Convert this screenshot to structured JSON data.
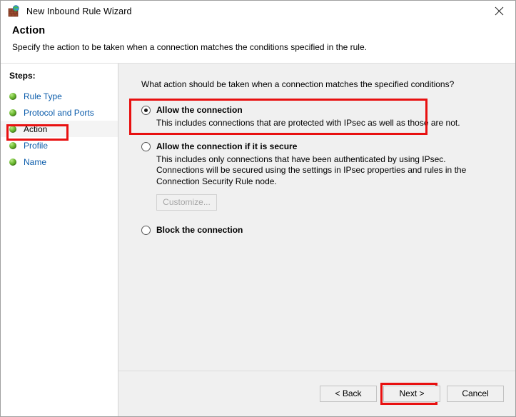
{
  "window": {
    "title": "New Inbound Rule Wizard",
    "icon": "firewall-globe-icon",
    "close_label": "×"
  },
  "header": {
    "title": "Action",
    "subtitle": "Specify the action to be taken when a connection matches the conditions specified in the rule."
  },
  "sidebar": {
    "label": "Steps:",
    "items": [
      {
        "label": "Rule Type",
        "current": false
      },
      {
        "label": "Protocol and Ports",
        "current": false
      },
      {
        "label": "Action",
        "current": true
      },
      {
        "label": "Profile",
        "current": false
      },
      {
        "label": "Name",
        "current": false
      }
    ]
  },
  "main": {
    "question": "What action should be taken when a connection matches the specified conditions?",
    "options": [
      {
        "title": "Allow the connection",
        "description": "This includes connections that are protected with IPsec as well as those are not.",
        "selected": true
      },
      {
        "title": "Allow the connection if it is secure",
        "description": "This includes only connections that have been authenticated by using IPsec.  Connections will be secured using the settings in IPsec properties and rules in the Connection Security Rule node.",
        "selected": false,
        "button": {
          "label": "Customize...",
          "enabled": false
        }
      },
      {
        "title": "Block the connection",
        "description": "",
        "selected": false
      }
    ]
  },
  "footer": {
    "back_label": "< Back",
    "next_label": "Next >",
    "cancel_label": "Cancel"
  },
  "annotations": {
    "color": "#e81010",
    "targets": [
      "sidebar-step-action",
      "option-allow-the-connection",
      "next-button"
    ]
  }
}
